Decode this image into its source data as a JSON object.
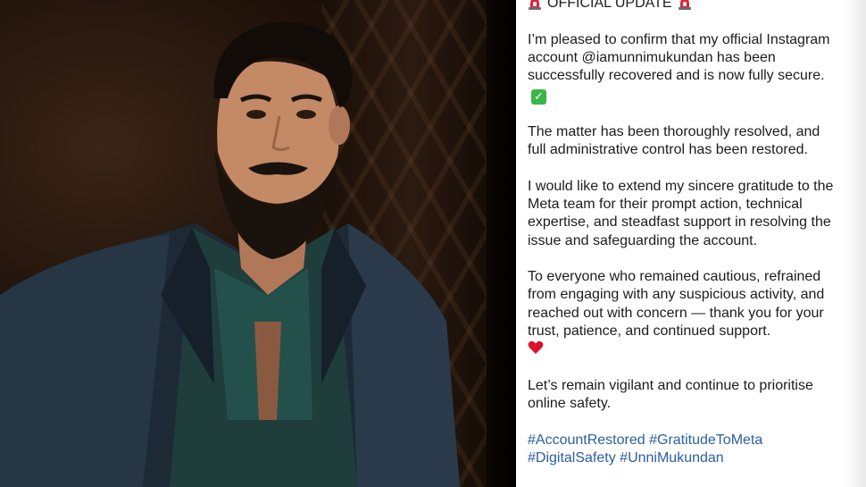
{
  "post": {
    "heading": "OFFICIAL UPDATE",
    "heading_icon": "police-siren-icon",
    "paragraphs": [
      "I’m pleased to confirm that my official Instagram account @iamunnimukundan has been successfully recovered and is now fully secure.",
      "The matter has been thoroughly resolved, and full administrative control has been restored.",
      "I would like to extend my sincere gratitude to the Meta team for their prompt action, technical expertise, and steadfast support in resolving the issue and safeguarding the account.",
      "To everyone who remained cautious, refrained from engaging with any suspicious activity, and reached out with concern — thank you for your trust, patience, and continued support.",
      "Let’s remain vigilant and continue to prioritise online safety."
    ],
    "emoji_after_p1": "check-mark-button-icon",
    "emoji_after_p4": "red-heart-icon",
    "hashtags": [
      "#AccountRestored",
      "#GratitudeToMeta",
      "#DigitalSafety",
      "#UnniMukundan"
    ],
    "colors": {
      "text": "#1c1c1c",
      "hashtag": "#2a5fa0",
      "siren": "#d7263d",
      "check": "#3bb54a",
      "heart": "#e0102a"
    }
  },
  "photo": {
    "subject_icon": "portrait-photo"
  }
}
